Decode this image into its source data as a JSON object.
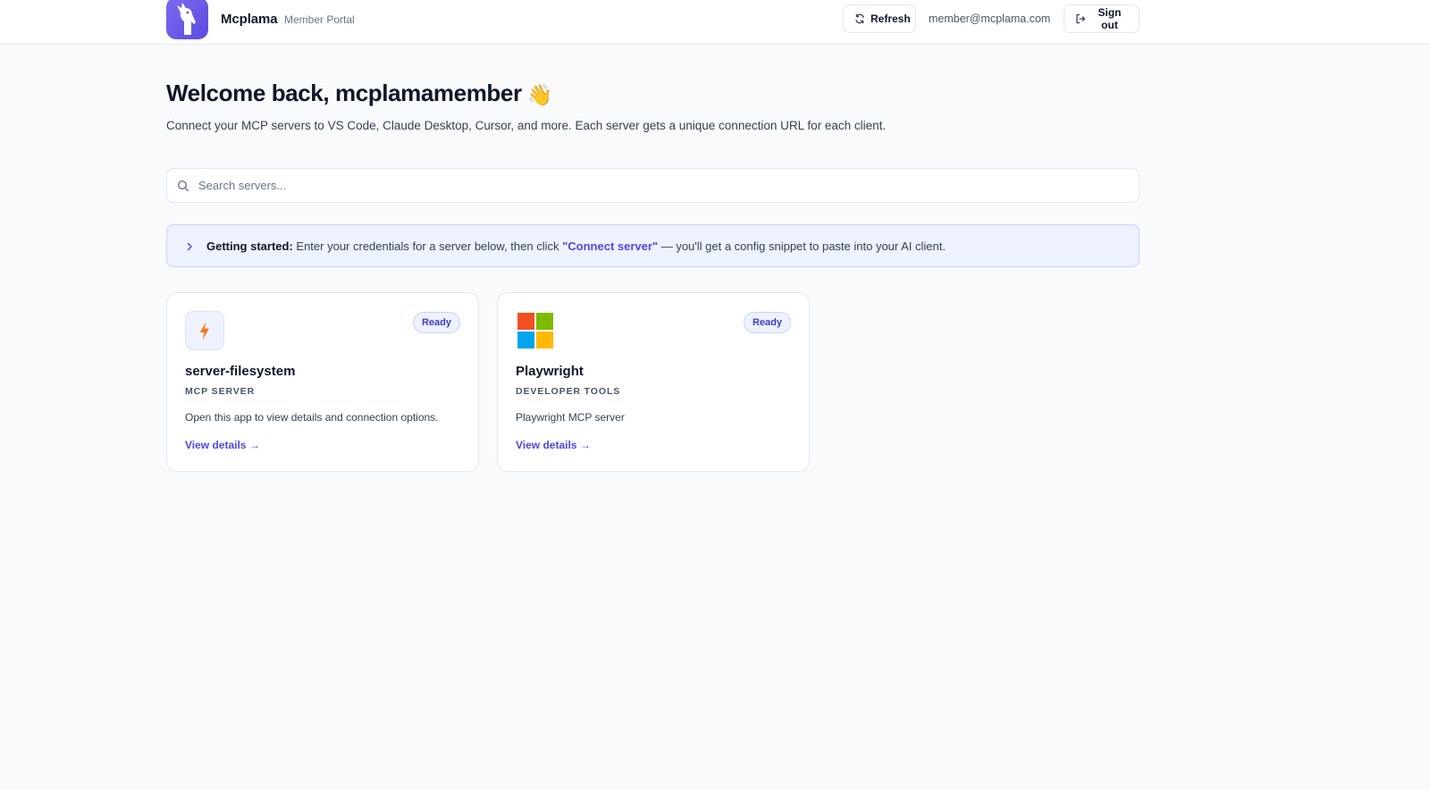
{
  "header": {
    "brand_name": "Mcplama",
    "brand_subtitle": "Member Portal",
    "logo_icon": "llama-icon",
    "refresh_label": "Refresh",
    "user_email": "member@mcplama.com",
    "signout_label": "Sign out"
  },
  "welcome": {
    "title": "Welcome back, mcplamamember",
    "emoji": "👋",
    "intro": "Connect your MCP servers to VS Code, Claude Desktop, Cursor, and more. Each server gets a unique connection URL for each client."
  },
  "search": {
    "placeholder": "Search servers...",
    "value": ""
  },
  "banner": {
    "heading": "Getting started:",
    "text_before": " Enter your credentials for a server below, then click ",
    "cta": "\"Connect server\"",
    "text_after": " — you'll get a config snippet to paste into your AI client."
  },
  "servers": [
    {
      "icon": "lightning-bolt-icon",
      "status": "Ready",
      "name": "server-filesystem",
      "category": "MCP SERVER",
      "description": "Open this app to view details and connection options.",
      "link": "View details →"
    },
    {
      "icon": "microsoft-logo-icon",
      "status": "Ready",
      "name": "Playwright",
      "category": "DEVELOPER TOOLS",
      "description": "Playwright MCP server",
      "link": "View details →"
    }
  ],
  "colors": {
    "accent": "#4f46e5",
    "logo_bg": "#6b5ce7",
    "bolt": "#f97316",
    "page_bg": "#f8fafc"
  }
}
